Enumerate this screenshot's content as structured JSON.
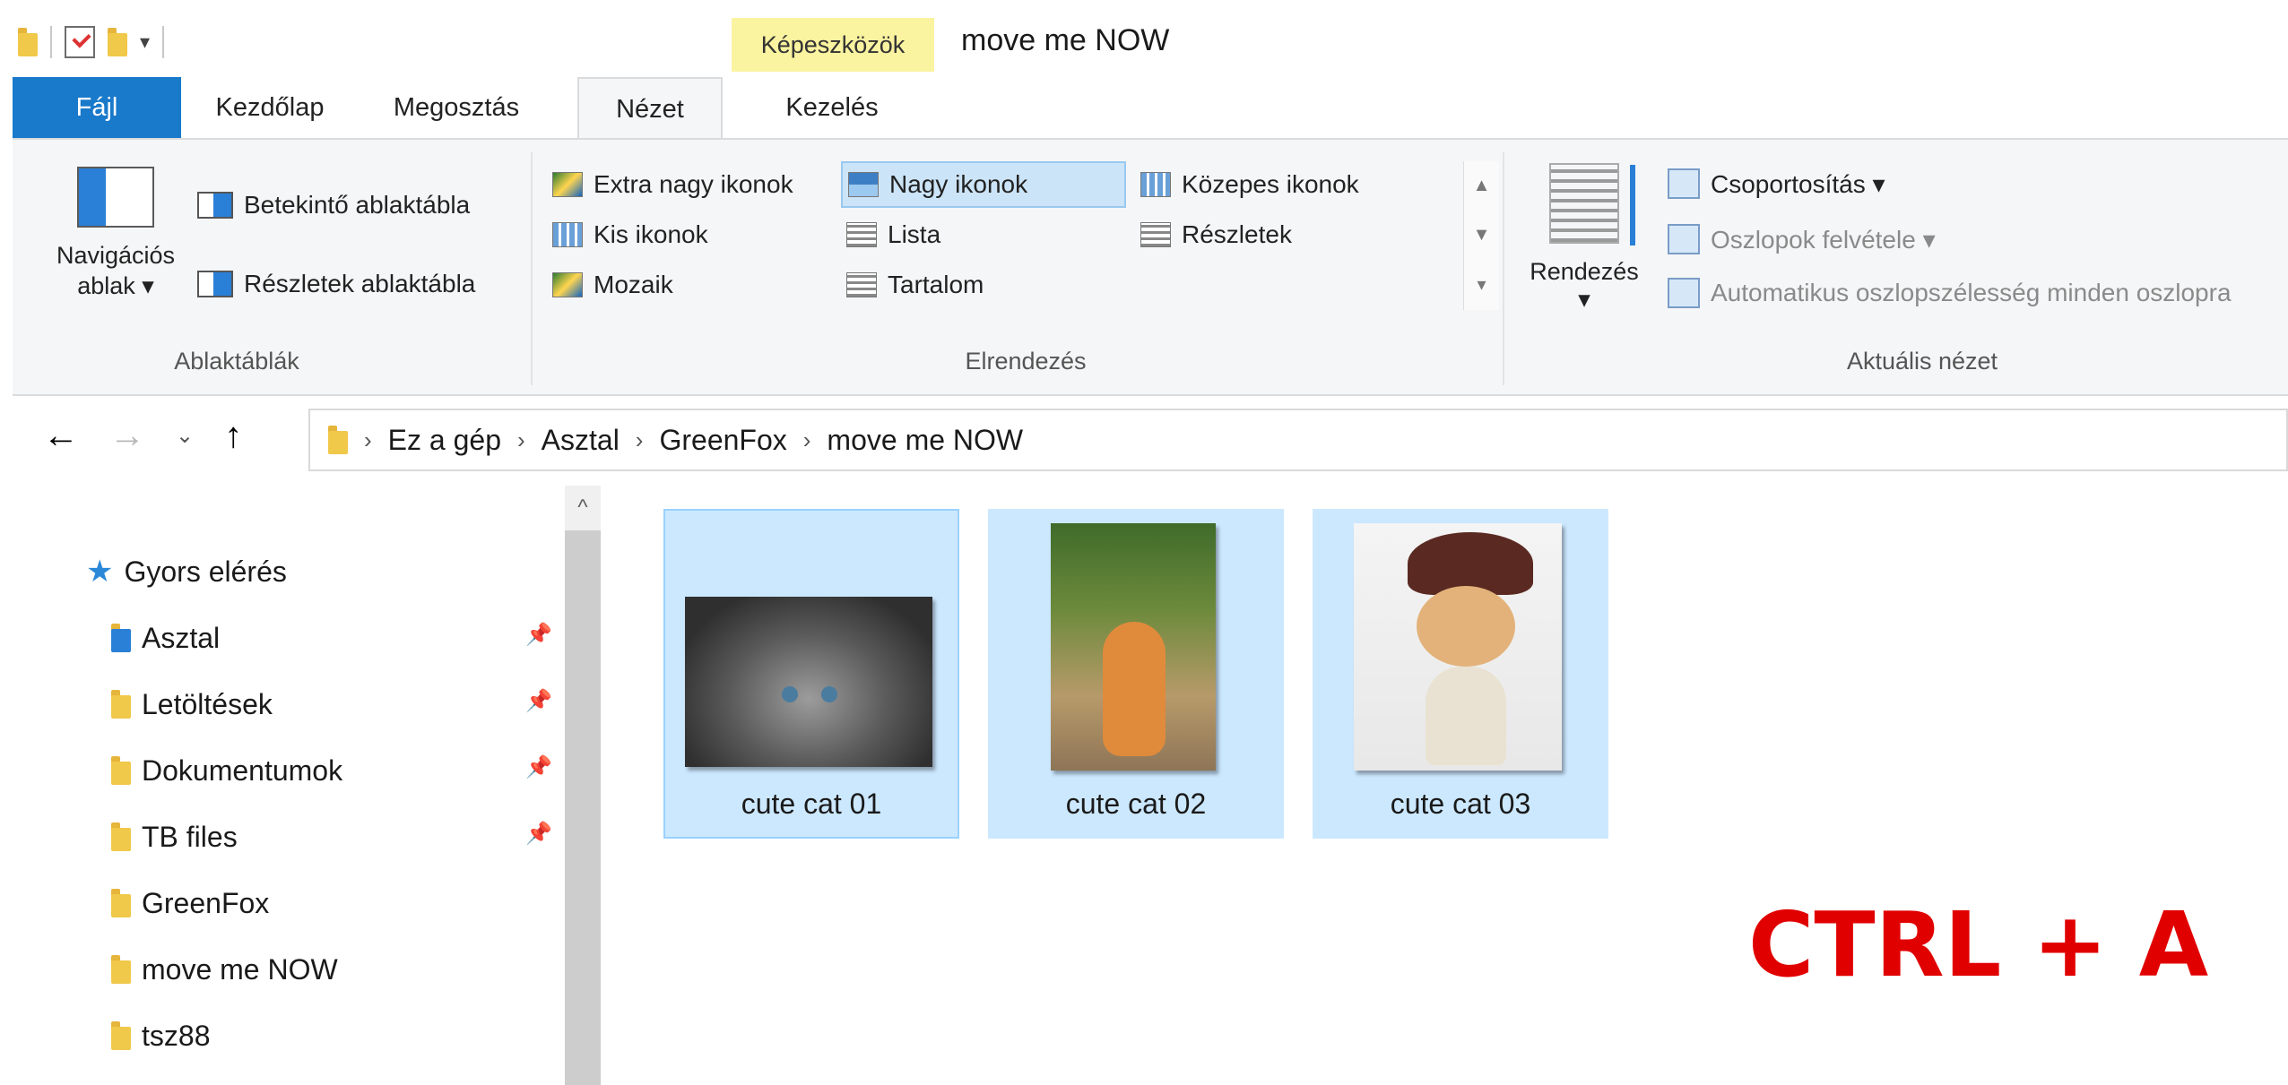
{
  "quick_access_toolbar": {
    "dropdown_glyph": "▾"
  },
  "contextual_tab": {
    "label": "Képeszközök"
  },
  "window": {
    "title": "move me NOW"
  },
  "ribbon_tabs": [
    "Fájl",
    "Kezdőlap",
    "Megosztás",
    "Nézet",
    "Kezelés"
  ],
  "ribbon": {
    "panes_group": {
      "label": "Ablaktáblák",
      "nav_pane_line1": "Navigációs",
      "nav_pane_line2": "ablak ▾",
      "preview_pane": "Betekintő ablaktábla",
      "details_pane": "Részletek ablaktábla"
    },
    "layout_group": {
      "label": "Elrendezés",
      "items": [
        "Extra nagy ikonok",
        "Nagy ikonok",
        "Közepes ikonok",
        "Kis ikonok",
        "Lista",
        "Részletek",
        "Mozaik",
        "Tartalom"
      ],
      "selected": "Nagy ikonok"
    },
    "current_view_group": {
      "label": "Aktuális nézet",
      "sort_by": "Rendezés",
      "sort_arrow": "▾",
      "group_by": "Csoportosítás ▾",
      "add_columns": "Oszlopok felvétele ▾",
      "autosize_columns": "Automatikus oszlopszélesség minden oszlopra"
    }
  },
  "address": {
    "breadcrumb": [
      "Ez a gép",
      "Asztal",
      "GreenFox",
      "move me NOW"
    ]
  },
  "nav_pane": {
    "quick_access": "Gyors elérés",
    "items": [
      {
        "label": "Asztal",
        "pinned": true
      },
      {
        "label": "Letöltések",
        "pinned": true
      },
      {
        "label": "Dokumentumok",
        "pinned": true
      },
      {
        "label": "TB files",
        "pinned": true
      },
      {
        "label": "GreenFox",
        "pinned": false
      },
      {
        "label": "move me NOW",
        "pinned": false
      },
      {
        "label": "tsz88",
        "pinned": false
      }
    ]
  },
  "files": [
    {
      "name": "cute cat 01",
      "selected": true
    },
    {
      "name": "cute cat 02",
      "selected": true
    },
    {
      "name": "cute cat 03",
      "selected": true
    }
  ],
  "overlay": {
    "shortcut": "CTRL + A"
  },
  "colors": {
    "accent": "#1979ca",
    "selection": "#cce8ff",
    "overlay_text": "#e10000"
  }
}
